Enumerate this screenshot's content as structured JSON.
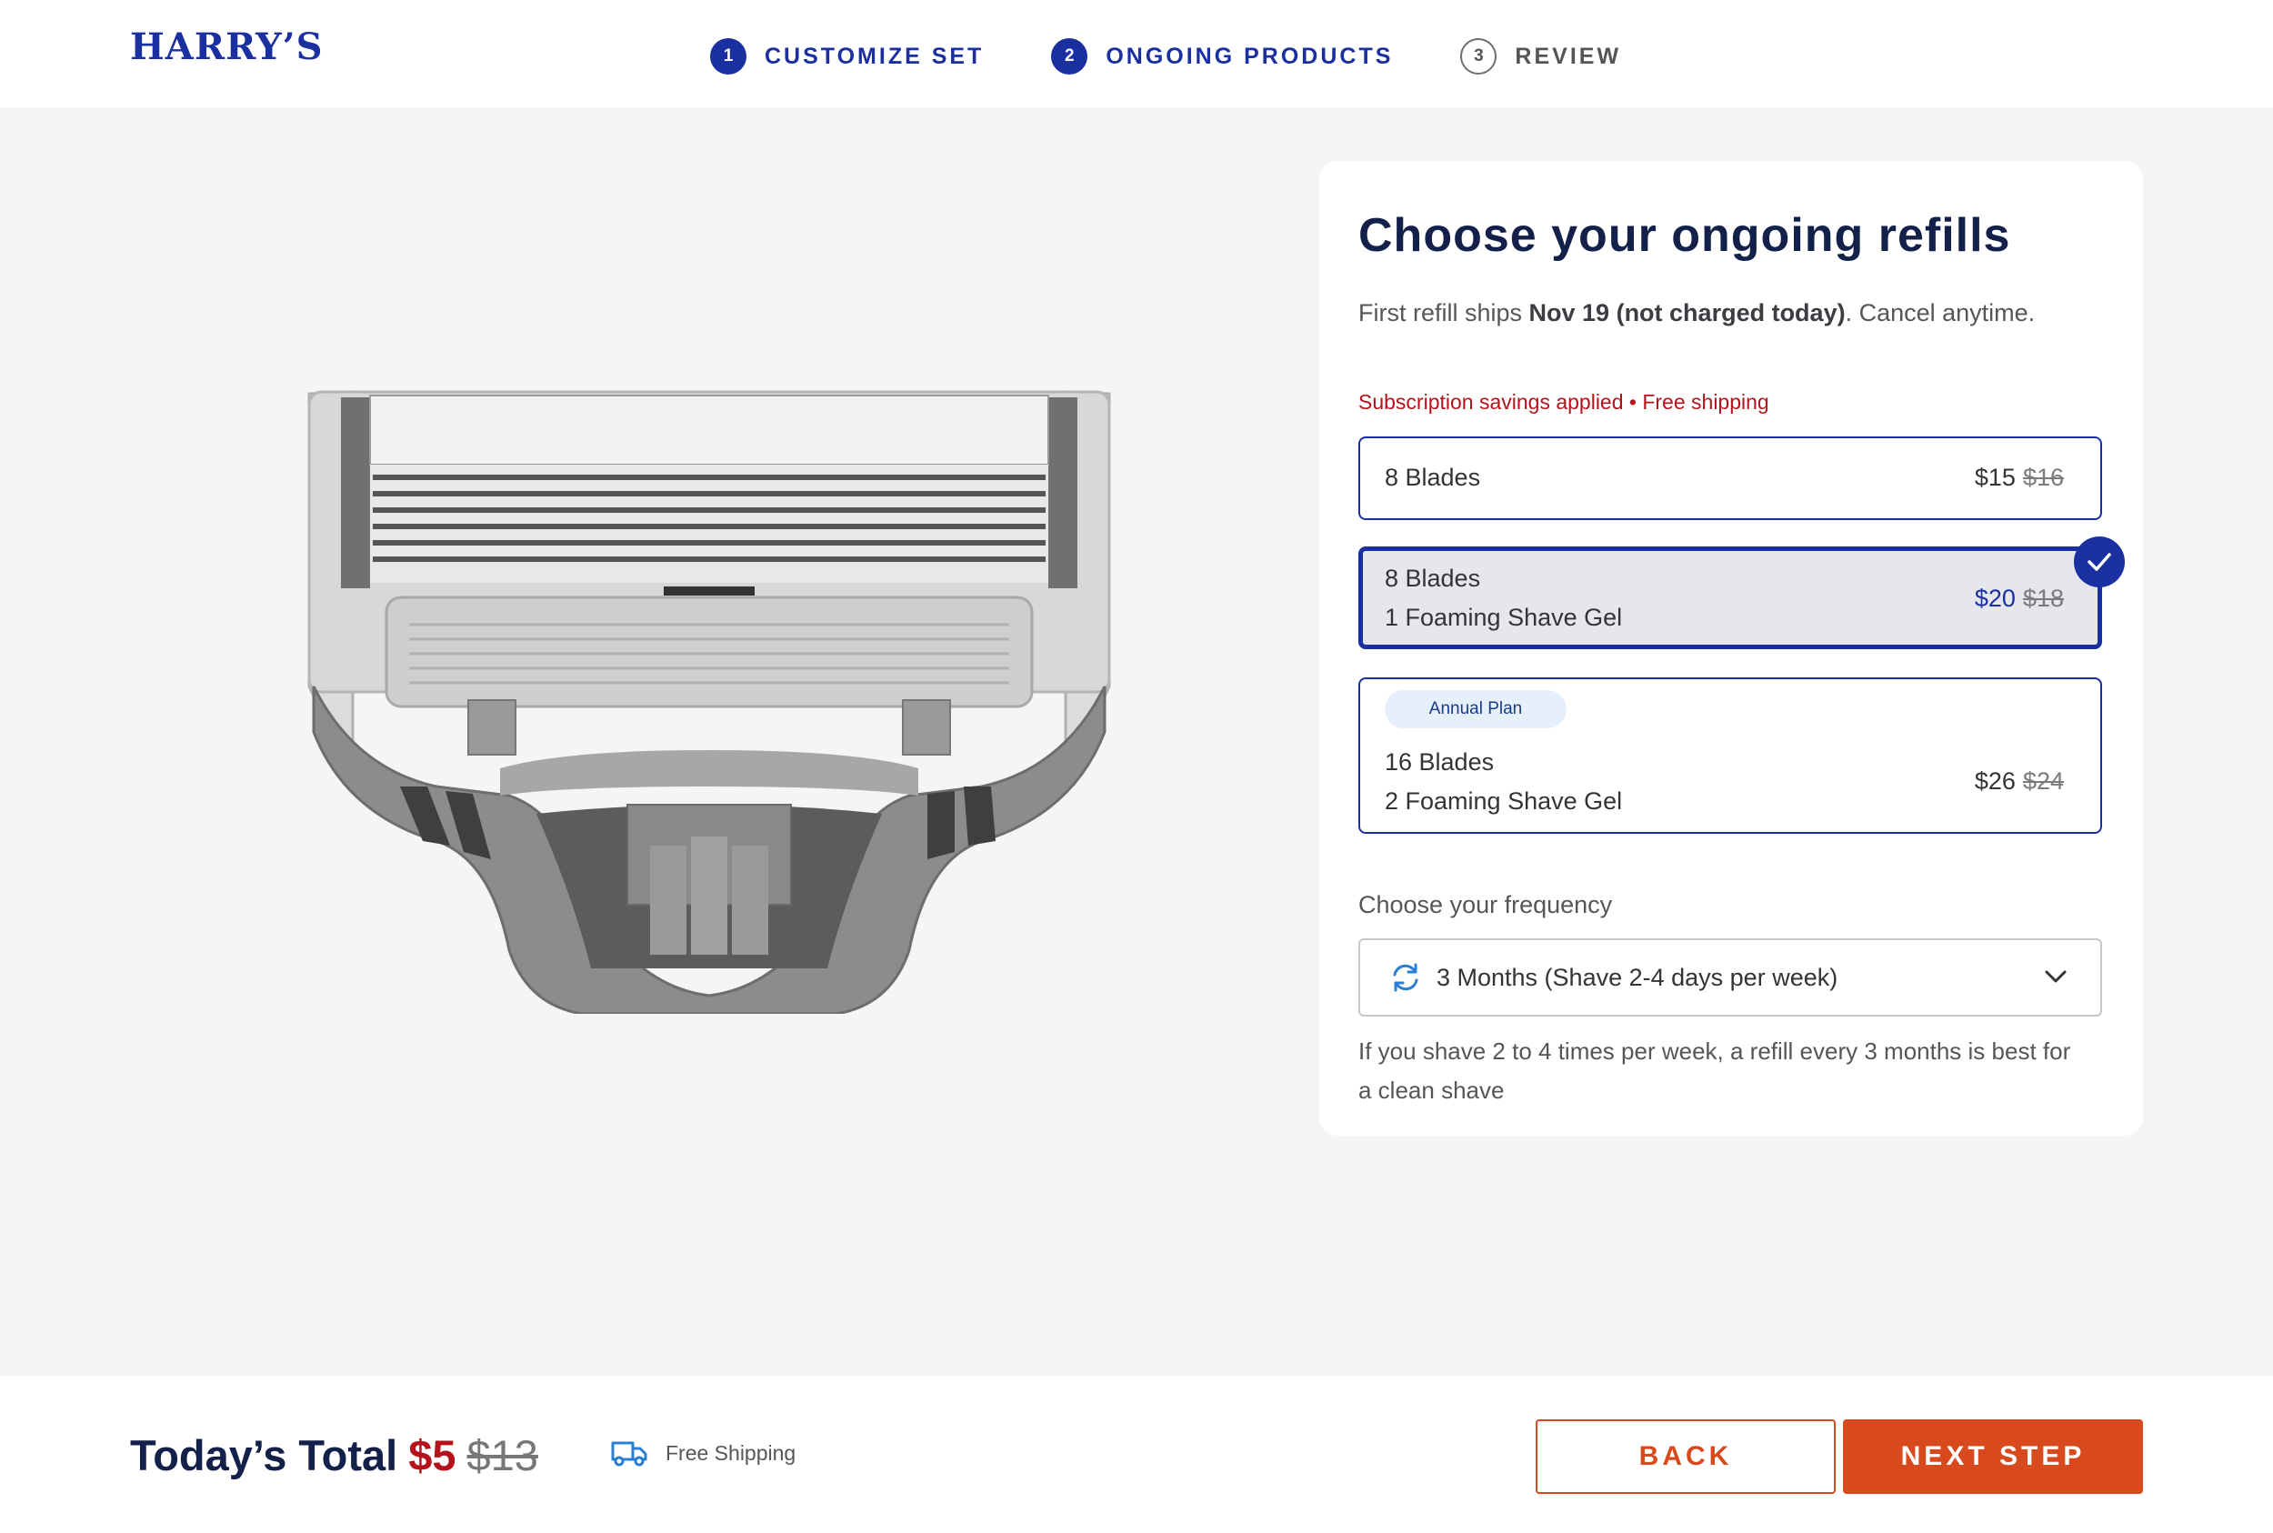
{
  "brand": {
    "logo_text": "HARRY’S",
    "color": "#1a2fa0"
  },
  "steps": [
    {
      "num": "1",
      "label": "CUSTOMIZE SET",
      "state": "complete"
    },
    {
      "num": "2",
      "label": "ONGOING PRODUCTS",
      "state": "current"
    },
    {
      "num": "3",
      "label": "REVIEW",
      "state": "upcoming"
    }
  ],
  "panel": {
    "title": "Choose your ongoing refills",
    "subtitle_prefix": "First refill ships ",
    "subtitle_bold": "Nov 19 (not charged today)",
    "subtitle_suffix": ". Cancel anytime.",
    "savings_note": "Subscription savings applied • Free shipping",
    "options": [
      {
        "line1": "8 Blades",
        "line2": "",
        "price": "$15",
        "old_price": "$16",
        "selected": false
      },
      {
        "line1": "8 Blades",
        "line2": "1 Foaming Shave Gel",
        "price": "$20",
        "old_price": "$18",
        "selected": true
      },
      {
        "badge": "Annual Plan",
        "line1": "16 Blades",
        "line2": "2 Foaming Shave Gel",
        "price": "$26",
        "old_price": "$24",
        "selected": false
      }
    ],
    "frequency_label": "Choose your frequency",
    "frequency_value": "3 Months (Shave 2-4 days per week)",
    "frequency_help": "If you shave 2 to 4 times per week, a refill every 3 months is best for a clean shave"
  },
  "footer": {
    "total_label": "Today’s Total",
    "total_now": "$5",
    "total_was": "$13",
    "shipping": "Free Shipping",
    "back_label": "BACK",
    "next_label": "NEXT STEP"
  },
  "colors": {
    "accent": "#1a2fa0",
    "cta": "#d84a1e",
    "sale": "#b5121b",
    "icon_blue": "#2a7fd4"
  },
  "icons": [
    "check-icon",
    "refresh-icon",
    "chevron-down-icon",
    "truck-icon"
  ]
}
